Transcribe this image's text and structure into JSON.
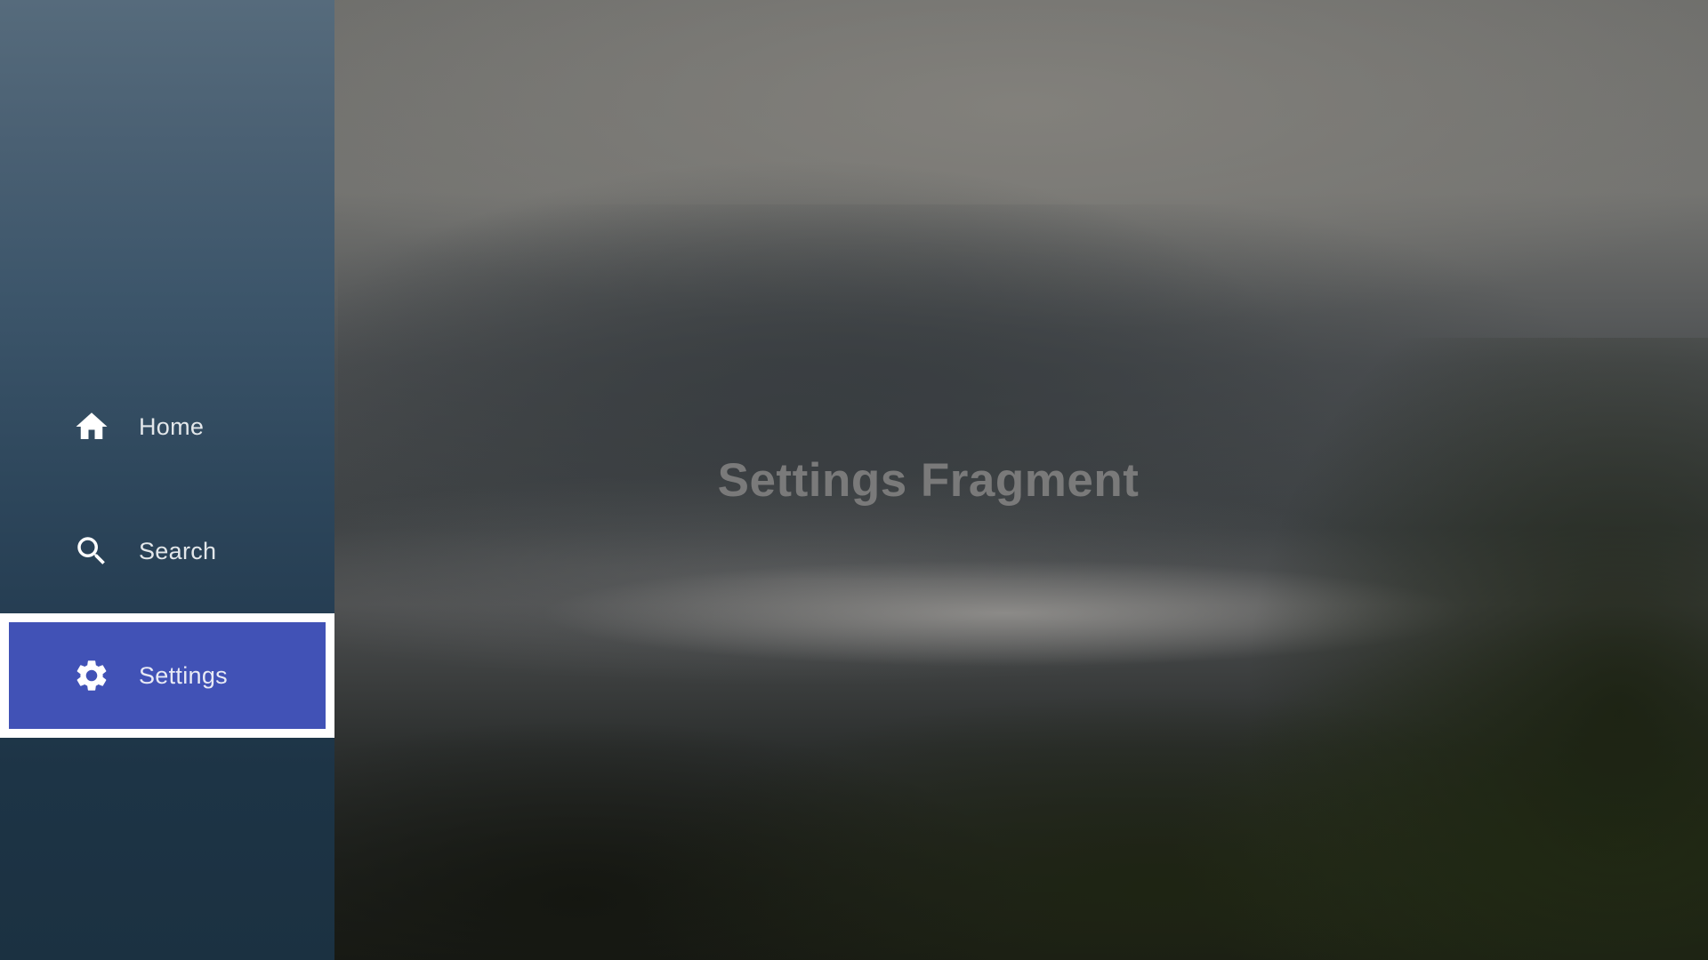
{
  "sidebar": {
    "items": [
      {
        "label": "Home",
        "icon": "home-icon"
      },
      {
        "label": "Search",
        "icon": "search-icon"
      },
      {
        "label": "Settings",
        "icon": "settings-icon",
        "selected": true
      }
    ]
  },
  "main": {
    "title": "Settings Fragment"
  },
  "colors": {
    "selected_bg": "#4152b6",
    "selected_border": "#ffffff",
    "title_text": "#7a7a7a"
  }
}
